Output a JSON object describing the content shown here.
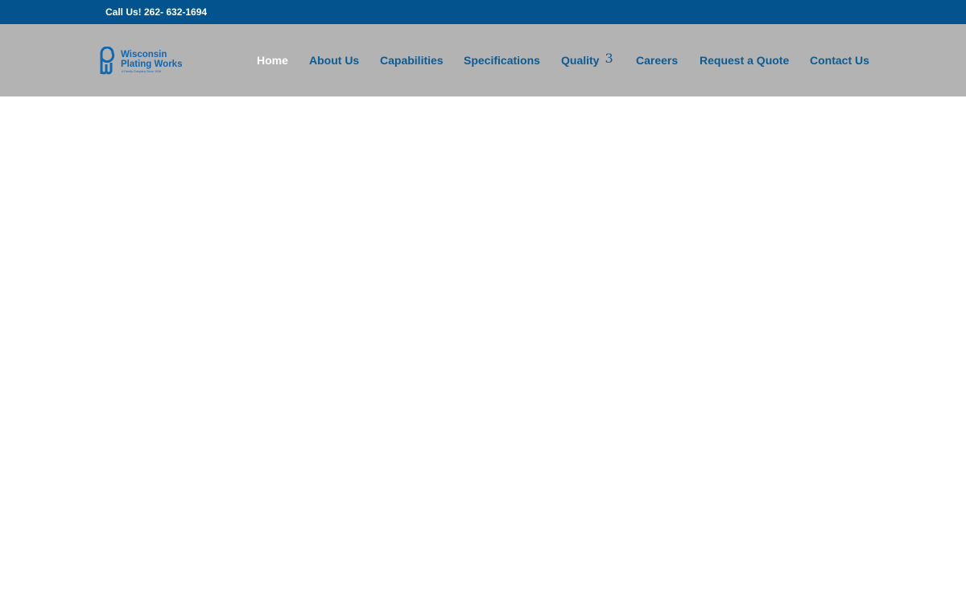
{
  "top_bar": {
    "phone_text": "Call Us! 262- 632-1694",
    "background_color": "#03548e"
  },
  "header": {
    "background_color": "#b3b3b3",
    "logo": {
      "name_line1": "Wisconsin",
      "name_line2": "Plating Works",
      "tagline": "A Family Company Since 1936",
      "icon": "pw-monogram-icon",
      "color": "#1168b1"
    }
  },
  "nav": {
    "items": [
      {
        "label": "Home",
        "active": true
      },
      {
        "label": "About Us",
        "active": false
      },
      {
        "label": "Capabilities",
        "active": false
      },
      {
        "label": "Specifications",
        "active": false
      },
      {
        "label": "Quality",
        "active": false,
        "dropdown_glyph": "3"
      },
      {
        "label": "Careers",
        "active": false
      },
      {
        "label": "Request a Quote",
        "active": false
      },
      {
        "label": "Contact Us",
        "active": false
      }
    ],
    "link_color": "#0b5c94",
    "active_color": "#ffffff"
  }
}
